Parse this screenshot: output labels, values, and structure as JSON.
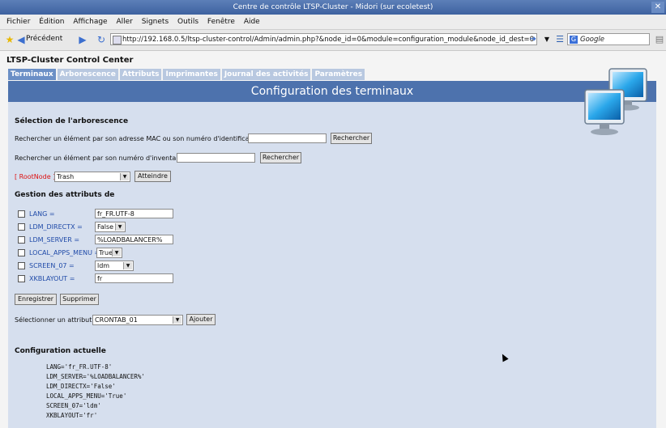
{
  "window": {
    "title": "Centre de contrôle LTSP-Cluster - Midori (sur ecoletest)"
  },
  "menu": [
    "Fichier",
    "Édition",
    "Affichage",
    "Aller",
    "Signets",
    "Outils",
    "Fenêtre",
    "Aide"
  ],
  "nav": {
    "back_label": "Précédent",
    "url": "http://192.168.0.5/ltsp-cluster-control/Admin/admin.php?&node_id=0&module=configuration_module&node_id_dest=0",
    "search_engine": "Google"
  },
  "app": {
    "title": "LTSP-Cluster Control Center",
    "tabs": [
      "Terminaux",
      "Arborescence",
      "Attributs",
      "Imprimantes",
      "Journal des activités",
      "Paramètres"
    ],
    "active_tab": "Terminaux",
    "header": "Configuration des terminaux"
  },
  "tree_selection": {
    "title": "Sélection de l'arborescence",
    "mac_label": "Rechercher un élément par son adresse MAC ou son numéro d'identification",
    "mac_value": "",
    "mac_button": "Rechercher",
    "inventory_label": "Rechercher un élément par son numéro d'inventaire:",
    "inventory_value": "",
    "inventory_button": "Rechercher",
    "root_label": "[ RootNode ]",
    "node_select": "Trash",
    "goto_button": "Atteindre"
  },
  "attributes": {
    "title": "Gestion des attributs de",
    "items": [
      {
        "name": "LANG =",
        "value": "fr_FR.UTF-8",
        "type": "text"
      },
      {
        "name": "LDM_DIRECTX =",
        "value": "False",
        "type": "select"
      },
      {
        "name": "LDM_SERVER =",
        "value": "%LOADBALANCER%",
        "type": "text"
      },
      {
        "name": "LOCAL_APPS_MENU =",
        "value": "True",
        "type": "select"
      },
      {
        "name": "SCREEN_07 =",
        "value": "ldm",
        "type": "select"
      },
      {
        "name": "XKBLAYOUT =",
        "value": "fr",
        "type": "text"
      }
    ],
    "save_button": "Enregistrer",
    "delete_button": "Supprimer",
    "select_label": "Sélectionner un attribut :",
    "select_value": "CRONTAB_01",
    "add_button": "Ajouter"
  },
  "current_config": {
    "title": "Configuration actuelle",
    "lines": [
      "LANG='fr_FR.UTF-8'",
      "LDM_SERVER='%LOADBALANCER%'",
      "LDM_DIRECTX='False'",
      "LOCAL_APPS_MENU='True'",
      "SCREEN_07='ldm'",
      "XKBLAYOUT='fr'"
    ]
  },
  "colors": {
    "header_blue": "#4d72ad",
    "panel_bg": "#d6dfee",
    "tab_inactive": "#b8c8e0",
    "tab_active": "#6b8fc6",
    "attr_blue": "#1f4aa8",
    "root_red": "#dd1111"
  }
}
